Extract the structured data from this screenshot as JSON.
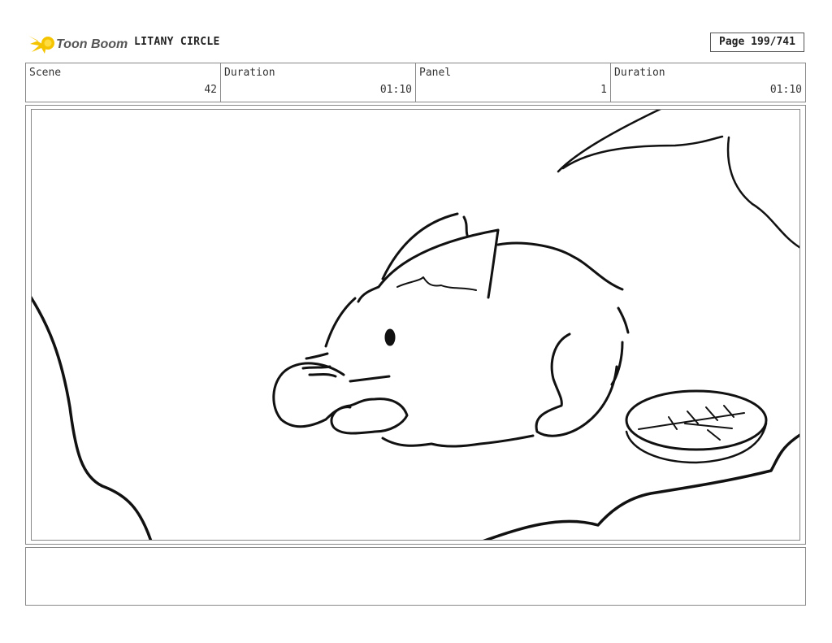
{
  "header": {
    "brand": "Toon Boom",
    "project_title": "LITANY CIRCLE",
    "page_indicator": "Page 199/741"
  },
  "info_bar": {
    "scene_label": "Scene",
    "scene_value": "42",
    "scene_duration_label": "Duration",
    "scene_duration_value": "01:10",
    "panel_label": "Panel",
    "panel_value": "1",
    "panel_duration_label": "Duration",
    "panel_duration_value": "01:10"
  },
  "notes": {
    "text": ""
  },
  "colors": {
    "brand_yellow": "#f5c400",
    "brand_text": "#555555",
    "ink": "#111111",
    "border": "#888888"
  }
}
